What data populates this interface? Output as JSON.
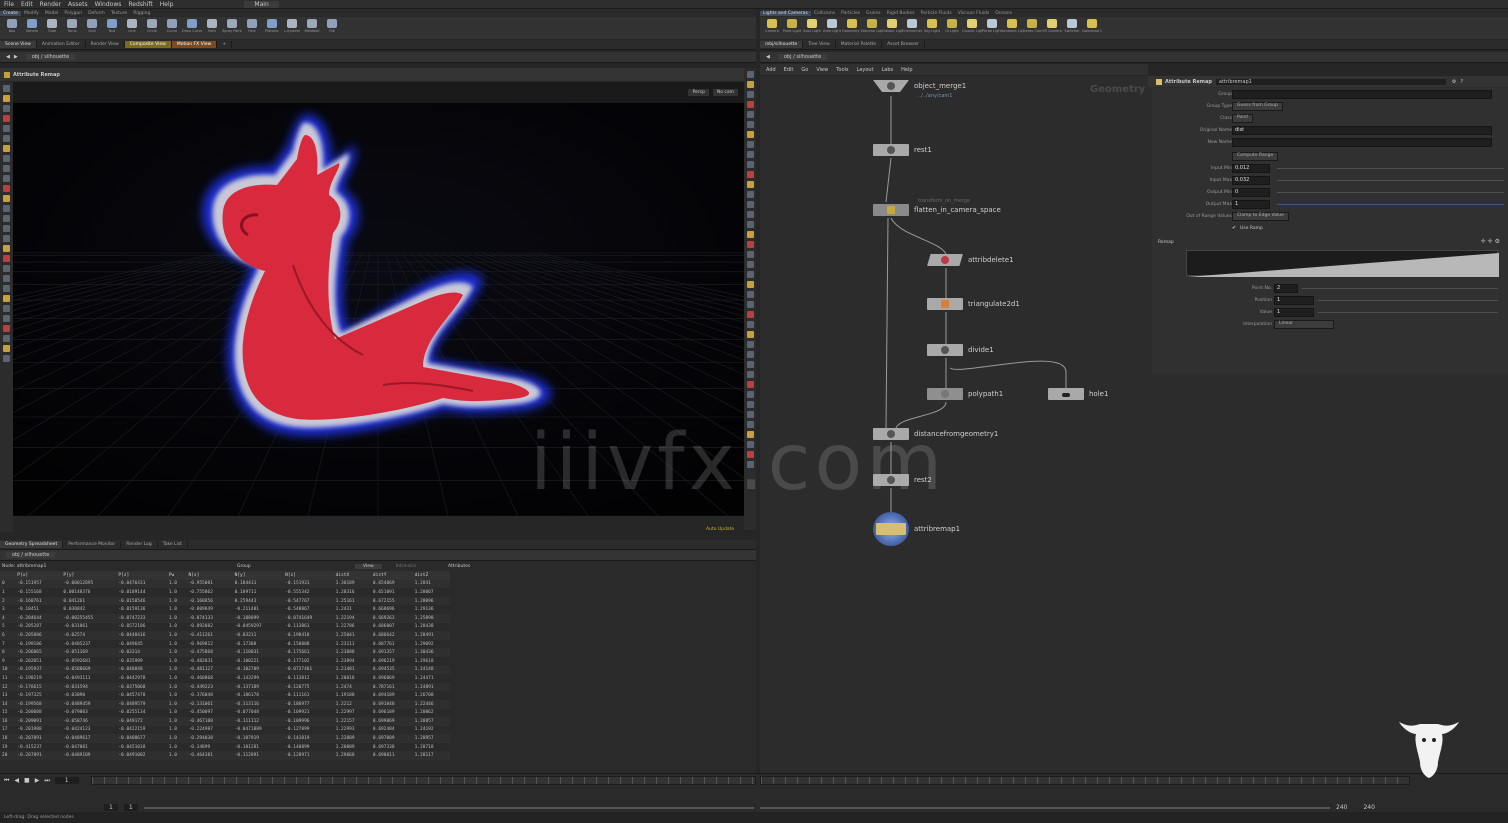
{
  "menu": [
    "File",
    "Edit",
    "Render",
    "Assets",
    "Windows",
    "Redshift",
    "Help"
  ],
  "desktop": "Main",
  "shelf_tools_left": [
    "Box",
    "Sphere",
    "Tube",
    "Torus",
    "Grid",
    "Null",
    "Line",
    "Circle",
    "Curve",
    "Draw Curve",
    "Path",
    "Spray Paint",
    "Font",
    "Platonic",
    "L-System",
    "Metaball",
    "File"
  ],
  "shelf_tools_right": [
    "Camera",
    "Point Light",
    "Spot Light",
    "Area Light",
    "Geometry Light",
    "Volume Light",
    "Distant Light",
    "Environment Light",
    "Sky Light",
    "GI Light",
    "Caustic Light",
    "Portal Light",
    "Ambient Light",
    "Stereo Camera",
    "VR Camera",
    "Switcher",
    "Gamepad Camera"
  ],
  "viewport": {
    "tabs": [
      "Scene View",
      "Animation Editor",
      "Render View",
      "Composite View",
      "Motion FX View"
    ],
    "path": "obj / silhouette",
    "node_title": "Attribute Remap",
    "persp": "Persp",
    "cam": "No cam"
  },
  "spreadsheet": {
    "tabs": [
      "Geometry Spreadsheet",
      "Performance Monitor",
      "Render Log",
      "Take List"
    ],
    "path": "obj / silhouette",
    "node_label": "Node: attribremap1",
    "group_label": "Group",
    "view_label": "View",
    "intrinsics_label": "Intrinsics",
    "attributes_label": "Attributes",
    "columns": [
      "",
      "P[x]",
      "P[y]",
      "P[z]",
      "Pw",
      "N[x]",
      "N[y]",
      "N[z]",
      "distX",
      "distY",
      "distZ"
    ],
    "rows": [
      [
        "0",
        "-0.151957",
        "-0.00012895",
        "-0.0476431",
        "1.0",
        "-0.955081",
        "0.184411",
        "-0.151931",
        "1.30189",
        "0.654869",
        "1.2841"
      ],
      [
        "1",
        "-0.155168",
        "0.00148376",
        "-0.0189144",
        "1.0",
        "-0.755862",
        "0.189711",
        "-0.555342",
        "1.28316",
        "0.651091",
        "1.28007"
      ],
      [
        "2",
        "-0.160761",
        "0.041261",
        "-0.0150546",
        "1.0",
        "-0.168856",
        "0.259443",
        "-0.547767",
        "1.25161",
        "0.672155",
        "1.28096"
      ],
      [
        "3",
        "-0.18451",
        "0.030842",
        "-0.0159136",
        "1.0",
        "-0.809849",
        "-0.211481",
        "-0.548867",
        "1.2431",
        "0.668696",
        "1.29136"
      ],
      [
        "4",
        "-0.204644",
        "-0.00255455",
        "-0.0747233",
        "1.0",
        "-0.874133",
        "-0.188099",
        "-0.0741649",
        "1.22194",
        "0.669263",
        "1.25898"
      ],
      [
        "5",
        "-0.205287",
        "-0.031861",
        "-0.0572186",
        "1.0",
        "-0.892082",
        "-0.0459297",
        "-0.113861",
        "1.22786",
        "0.686007",
        "1.28438"
      ],
      [
        "6",
        "-0.205886",
        "-0.02574",
        "-0.0448416",
        "1.0",
        "-0.411261",
        "-0.03211",
        "-0.198418",
        "1.25041",
        "0.686642",
        "1.28491"
      ],
      [
        "7",
        "-0.199186",
        "-0.0405237",
        "-0.049645",
        "1.0",
        "-0.969812",
        "-0.17308",
        "-0.150808",
        "1.23111",
        "0.687761",
        "1.29092"
      ],
      [
        "8",
        "-0.206865",
        "-0.051169",
        "-0.03314",
        "1.0",
        "-0.475868",
        "-0.118031",
        "-0.175661",
        "1.23888",
        "0.691357",
        "1.30436"
      ],
      [
        "9",
        "-0.202051",
        "-0.0592681",
        "-0.035989",
        "1.0",
        "-0.482031",
        "-0.100221",
        "-0.177102",
        "1.23894",
        "0.696219",
        "1.29618"
      ],
      [
        "10",
        "-0.195937",
        "-0.0588669",
        "-0.048848",
        "1.0",
        "-0.481127",
        "-0.102709",
        "-0.0737481",
        "1.21481",
        "0.694535",
        "1.24148"
      ],
      [
        "11",
        "-0.190219",
        "-0.0493111",
        "-0.0442978",
        "1.0",
        "-0.460868",
        "-0.143299",
        "-0.113812",
        "1.20818",
        "0.696869",
        "1.24471"
      ],
      [
        "12",
        "-0.176615",
        "-0.031594",
        "-0.0375068",
        "1.0",
        "-0.449223",
        "-0.137189",
        "-0.120775",
        "1.2474",
        "0.787161",
        "1.24891"
      ],
      [
        "13",
        "-0.197325",
        "-0.03090",
        "-0.0457478",
        "1.0",
        "-0.376048",
        "-0.186178",
        "-0.111161",
        "1.19188",
        "0.694189",
        "1.26708"
      ],
      [
        "14",
        "-0.199568",
        "-0.0489459",
        "-0.0489579",
        "1.0",
        "-0.131061",
        "-0.113116",
        "-0.186977",
        "1.2212",
        "0.691848",
        "1.22446"
      ],
      [
        "15",
        "-0.200088",
        "-0.079803",
        "-0.0255134",
        "1.0",
        "-0.450097",
        "-0.077048",
        "-0.109921",
        "1.22997",
        "0.696189",
        "1.20862"
      ],
      [
        "16",
        "-0.209091",
        "-0.058746",
        "-0.049172",
        "1.0",
        "-0.467108",
        "-0.111112",
        "-0.109996",
        "1.22157",
        "0.699869",
        "1.28857"
      ],
      [
        "17",
        "-0.201988",
        "-0.0424123",
        "-0.0422159",
        "1.0",
        "-0.224987",
        "-0.0471889",
        "-0.127899",
        "1.22993",
        "0.692484",
        "1.24192"
      ],
      [
        "18",
        "-0.207891",
        "-0.0489617",
        "-0.0408677",
        "1.0",
        "-0.294038",
        "-0.107919",
        "-0.141819",
        "1.22889",
        "0.697089",
        "1.20957"
      ],
      [
        "19",
        "-0.415237",
        "-0.047081",
        "-0.0451018",
        "1.0",
        "-0.14899",
        "-0.101281",
        "-0.148899",
        "1.20889",
        "0.697338",
        "1.28718"
      ],
      [
        "20",
        "-0.207891",
        "-0.0489109",
        "-0.0491002",
        "1.0",
        "-0.464381",
        "-0.112891",
        "-0.128971",
        "1.29868",
        "0.698811",
        "1.28117"
      ]
    ]
  },
  "network": {
    "tabs": [
      "/obj/silhouette",
      "Tree View",
      "Material Palette",
      "Asset Browser"
    ],
    "path": "obj / silhouette",
    "menu": [
      "Add",
      "Edit",
      "Go",
      "View",
      "Tools",
      "Layout",
      "Labs",
      "Help"
    ],
    "context_label": "Geometry",
    "nodes": [
      {
        "name": "object_merge1",
        "sub": "../../any/cam1"
      },
      {
        "name": "rest1",
        "sub": ""
      },
      {
        "name": "flatten_in_camera_space",
        "sub": "transform_on_merge"
      },
      {
        "name": "attribdelete1",
        "sub": ""
      },
      {
        "name": "triangulate2d1",
        "sub": ""
      },
      {
        "name": "divide1",
        "sub": ""
      },
      {
        "name": "polypath1",
        "sub": ""
      },
      {
        "name": "hole1",
        "sub": ""
      },
      {
        "name": "distancefromgeometry1",
        "sub": ""
      },
      {
        "name": "rest2",
        "sub": ""
      },
      {
        "name": "attribremap1",
        "sub": ""
      }
    ]
  },
  "params": {
    "header_type": "Attribute Remap",
    "header_name": "attribremap1",
    "fields": [
      {
        "label": "Group",
        "value": ""
      },
      {
        "label": "Group Type",
        "value": "Guess from Group"
      },
      {
        "label": "Class",
        "value": "Point"
      },
      {
        "label": "Original Name",
        "value": "dist"
      },
      {
        "label": "New Name",
        "value": ""
      },
      {
        "label": "",
        "value": "Compute Range"
      },
      {
        "label": "Input Min",
        "value": "0.012"
      },
      {
        "label": "Input Max",
        "value": "0.032"
      },
      {
        "label": "Output Min",
        "value": "0"
      },
      {
        "label": "Output Max",
        "value": "1"
      },
      {
        "label": "Out of Range Values",
        "value": "Clamp to Edge Value"
      }
    ],
    "use_ramp_label": "Use Ramp",
    "ramp_label": "Remap",
    "ramp_fields": [
      {
        "label": "Point No.",
        "value": "2"
      },
      {
        "label": "Position",
        "value": "1"
      },
      {
        "label": "Value",
        "value": "1"
      },
      {
        "label": "Interpolation",
        "value": "Linear"
      }
    ]
  },
  "timeline": {
    "frame": "1",
    "start": "1",
    "end_a": "240",
    "end_b": "240"
  },
  "viewport_status": "Auto Update",
  "status_text": "Left-drag: Drag selected nodes",
  "watermark": "iiivfx.com",
  "colors": {
    "accent": "#3e4a58",
    "node": "#a9a9a9",
    "remap_node": "#4f6fb5",
    "red": "#d4293b",
    "blue": "#1a2fd8"
  }
}
